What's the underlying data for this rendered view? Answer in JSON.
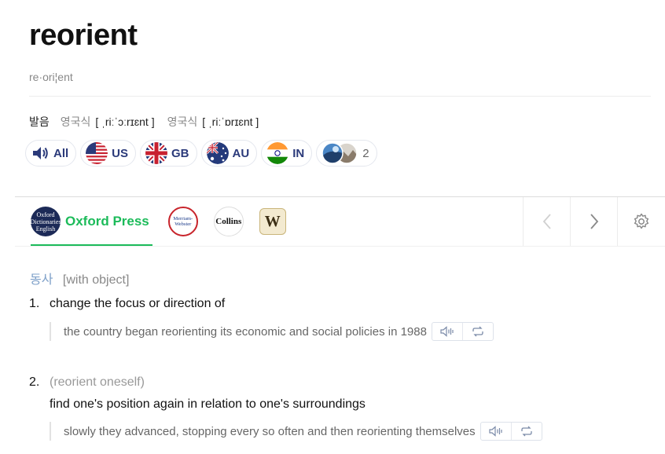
{
  "entry": {
    "headword": "reorient",
    "syllables": "re·ori¦ent"
  },
  "pronunciation": {
    "label": "발음",
    "variants": [
      {
        "name": "영국식",
        "ipa": "[ ˌriːˈɔːrɪɛnt ]"
      },
      {
        "name": "영국식",
        "ipa": "[ ˌriːˈɒrɪɛnt ]"
      }
    ]
  },
  "audio_buttons": [
    {
      "label": "All",
      "icon": "speaker-icon"
    },
    {
      "label": "US",
      "icon": "us-flag-icon"
    },
    {
      "label": "GB",
      "icon": "gb-flag-icon"
    },
    {
      "label": "AU",
      "icon": "au-flag-icon"
    },
    {
      "label": "IN",
      "icon": "in-flag-icon"
    },
    {
      "label": "2",
      "icon": "user-avatars-icon"
    }
  ],
  "dictionaries": {
    "active_label": "Oxford Press",
    "tabs": [
      {
        "name": "oxford",
        "logo_text": "Oxford Dictionaries English",
        "active": true
      },
      {
        "name": "merriam-webster",
        "logo_text": "Merriam-Webster",
        "active": false
      },
      {
        "name": "collins",
        "logo_text": "Collins",
        "active": false
      },
      {
        "name": "wordreference",
        "logo_text": "W",
        "active": false
      }
    ],
    "nav": {
      "prev_icon": "chevron-left-icon",
      "next_icon": "chevron-right-icon",
      "settings_icon": "gear-icon"
    }
  },
  "definitions": {
    "pos": "동사",
    "grammar": "[with object]",
    "senses": [
      {
        "number": "1.",
        "label": "",
        "definition": "change the focus or direction of",
        "example": "the country began reorienting its economic and social policies in 1988"
      },
      {
        "number": "2.",
        "label": "(reorient oneself)",
        "definition": "find one's position again in relation to one's surroundings",
        "example": "slowly they advanced, stopping every so often and then reorienting themselves"
      }
    ]
  },
  "colors": {
    "accent_green": "#1cbb5a",
    "pos_blue": "#7ea0c9",
    "pill_text": "#2b3a7a"
  }
}
